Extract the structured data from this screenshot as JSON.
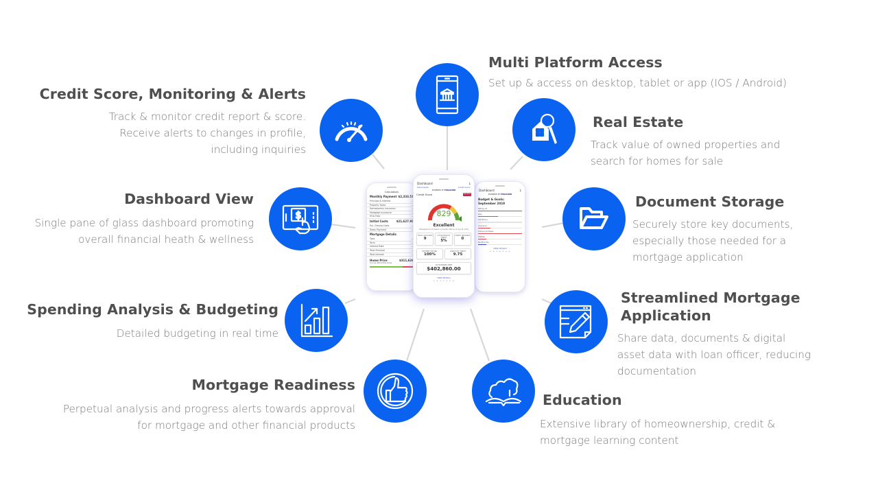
{
  "theme": {
    "accent": "#0a63f0",
    "title_color": "#4f4f4f",
    "desc_color": "#7a7a7a",
    "connector": "#d7d7d7"
  },
  "features": [
    {
      "id": "multi-platform",
      "icon": "tablet-bank-icon",
      "title": "Multi Platform Access",
      "desc": [
        "Set up & access on desktop, tablet or app (IOS / Android)"
      ]
    },
    {
      "id": "credit-score",
      "icon": "speedometer-icon",
      "title": "Credit Score, Monitoring & Alerts",
      "desc": [
        "Track & monitor credit report & score.",
        "Receive alerts to changes in profile,",
        "including inquiries"
      ]
    },
    {
      "id": "real-estate",
      "icon": "house-keys-icon",
      "title": "Real Estate",
      "desc": [
        "Track value of owned properties and",
        "search for homes for sale"
      ]
    },
    {
      "id": "dashboard-view",
      "icon": "tablet-touch-dollar-icon",
      "title": "Dashboard View",
      "desc": [
        "Single pane of glass dashboard promoting",
        "overall financial heath & wellness"
      ]
    },
    {
      "id": "document-storage",
      "icon": "folder-open-icon",
      "title": "Document Storage",
      "desc": [
        "Securely store key documents,",
        "especially those needed for a",
        "mortgage application"
      ]
    },
    {
      "id": "spending-analysis",
      "icon": "bar-chart-growth-icon",
      "title": "Spending Analysis & Budgeting",
      "desc": [
        "Detailed budgeting in real time"
      ]
    },
    {
      "id": "streamlined-mortgage",
      "icon": "form-pencil-icon",
      "title": [
        "Streamlined Mortgage",
        "Application"
      ],
      "desc": [
        "Share data, documents & digital",
        "asset data with loan officer, reducing",
        "documentation"
      ]
    },
    {
      "id": "mortgage-readiness",
      "icon": "thumbs-up-icon",
      "title": "Mortgage Readiness",
      "desc": [
        "Perpetual analysis and progress alerts towards approval",
        "for mortgage and other financial products"
      ]
    },
    {
      "id": "education",
      "icon": "book-cloud-icon",
      "title": "Education",
      "desc": [
        "Extensive library of homeownership, credit &",
        "mortgage learning content"
      ]
    }
  ],
  "phones": {
    "left": {
      "title": "Calculators",
      "monthly_payment_label": "Monthly Payment",
      "monthly_payment": "$2,333.51",
      "monthly_rows": [
        "Principal & Interest",
        "Property Taxes",
        "Homeowners Insurance",
        "Mortgage Insurance",
        "HOA Fees"
      ],
      "initial_costs_label": "Initial Costs",
      "initial_costs": "$21,627.98",
      "initial_rows": [
        "Est. Closing Costs",
        "Down Payment"
      ],
      "mortgage_details_label": "Mortgage Details",
      "mortgage_rows": [
        "Type",
        "Term",
        "Interest Rate",
        "Total Principal",
        "Total Interest"
      ],
      "home_price_label": "Home Price",
      "home_price_sub": "You can afford this home",
      "home_price": "$311,626",
      "slider_fraction": 0.75
    },
    "center": {
      "header": "Dashboard",
      "total_assets_label": "Total Assets:",
      "credit_score_label": "Credit Score:",
      "powered_by": "POWERED BY",
      "brand": "FINLOCKER",
      "card_title": "Credit Score",
      "tag": "EQUIFAX",
      "score": "829",
      "rating": "Excellent",
      "note": "VantageScore 3.0 based on Equifax data as of Aug 26, 2019",
      "stats_row1": [
        {
          "label": "TOTAL ACCOUNTS",
          "value": "9"
        },
        {
          "label": "UTILIZATION OF CREDIT",
          "value": "5%"
        },
        {
          "label": "CREDIT INQUIRIES",
          "value": "0"
        }
      ],
      "stats_row2": [
        {
          "label": "PAYMENT HISTORY",
          "value": "100%"
        },
        {
          "label": "LENGTH OF CREDIT",
          "value": "9.75"
        }
      ],
      "debt_label": "OUTSTANDING DEBT",
      "debt": "$402,860.00",
      "link": "VIEW DETAILS",
      "page_dots": "• • • • • • •"
    },
    "right": {
      "header": "Dashboard",
      "powered_by": "POWERED BY",
      "brand": "FINLOCKER",
      "budget_title": "Budget & Goals: September 2019",
      "items": [
        {
          "name": "Eating out",
          "fraction": 1.0,
          "color": "red"
        },
        {
          "name": "Gas",
          "fraction": 0.45,
          "color": "red"
        },
        {
          "name": "Cell Phone",
          "fraction": 0.0,
          "color": "red"
        },
        {
          "name": "Insurance",
          "fraction": 0.28,
          "color": "red"
        },
        {
          "name": "Online purchases",
          "fraction": 1.0,
          "color": "red"
        },
        {
          "name": "Utilities",
          "fraction": 0.18,
          "color": "red"
        },
        {
          "name": "Monthly Fee",
          "fraction": 0.18,
          "color": "blue"
        }
      ],
      "link": "VIEW DETAILS",
      "page_dots": "• • • • • • •"
    }
  }
}
